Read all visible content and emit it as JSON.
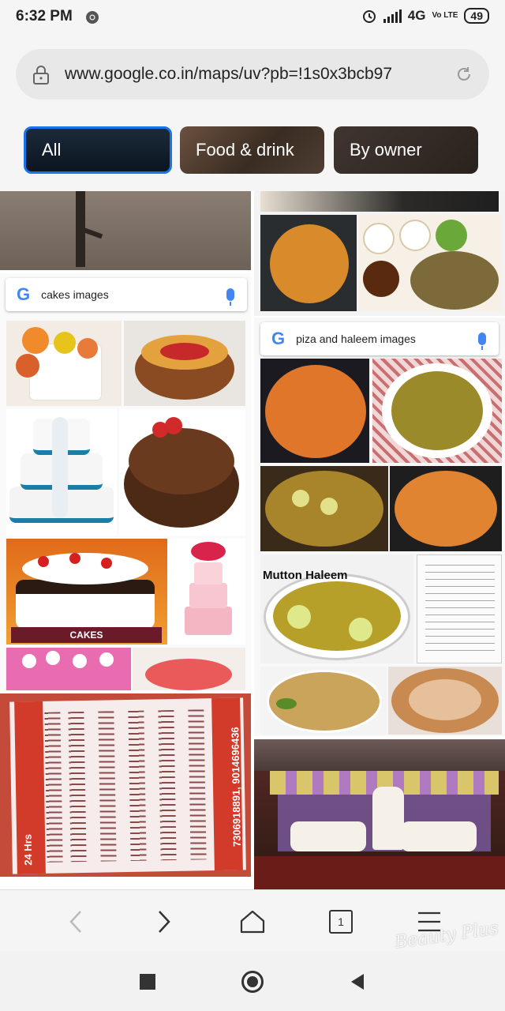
{
  "status_bar": {
    "time": "6:32 PM",
    "network": "4G",
    "volte": "Vo LTE",
    "battery": "49"
  },
  "url_bar": {
    "url": "www.google.co.in/maps/uv?pb=!1s0x3bcb97"
  },
  "filter_chips": {
    "all": "All",
    "food_drink": "Food & drink",
    "by_owner": "By owner"
  },
  "photos": {
    "cakes_search": {
      "query": "cakes images",
      "logo": "G"
    },
    "cakes_label": "CAKES",
    "food_search": {
      "query": "piza and haleem images",
      "logo": "G"
    },
    "mutton_label": "Mutton Haleem",
    "menu_phone": "7306918891, 9014696436",
    "menu_header": "24 Hrs"
  },
  "bottom_nav": {
    "tab_count": "1"
  },
  "watermark": "Beauty Plus",
  "colors": {
    "accent": "#1a73e8",
    "google_blue": "#4285f4"
  }
}
